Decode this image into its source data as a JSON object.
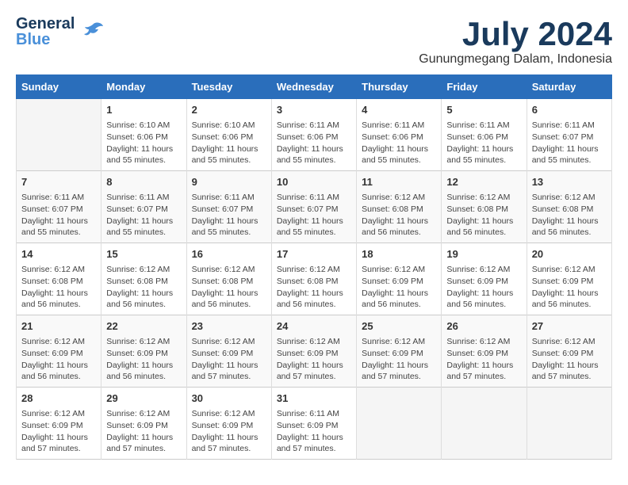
{
  "logo": {
    "line1": "General",
    "line2": "Blue"
  },
  "title": {
    "month_year": "July 2024",
    "location": "Gunungmegang Dalam, Indonesia"
  },
  "weekdays": [
    "Sunday",
    "Monday",
    "Tuesday",
    "Wednesday",
    "Thursday",
    "Friday",
    "Saturday"
  ],
  "weeks": [
    [
      {
        "day": "",
        "info": ""
      },
      {
        "day": "1",
        "info": "Sunrise: 6:10 AM\nSunset: 6:06 PM\nDaylight: 11 hours\nand 55 minutes."
      },
      {
        "day": "2",
        "info": "Sunrise: 6:10 AM\nSunset: 6:06 PM\nDaylight: 11 hours\nand 55 minutes."
      },
      {
        "day": "3",
        "info": "Sunrise: 6:11 AM\nSunset: 6:06 PM\nDaylight: 11 hours\nand 55 minutes."
      },
      {
        "day": "4",
        "info": "Sunrise: 6:11 AM\nSunset: 6:06 PM\nDaylight: 11 hours\nand 55 minutes."
      },
      {
        "day": "5",
        "info": "Sunrise: 6:11 AM\nSunset: 6:06 PM\nDaylight: 11 hours\nand 55 minutes."
      },
      {
        "day": "6",
        "info": "Sunrise: 6:11 AM\nSunset: 6:07 PM\nDaylight: 11 hours\nand 55 minutes."
      }
    ],
    [
      {
        "day": "7",
        "info": "Sunrise: 6:11 AM\nSunset: 6:07 PM\nDaylight: 11 hours\nand 55 minutes."
      },
      {
        "day": "8",
        "info": "Sunrise: 6:11 AM\nSunset: 6:07 PM\nDaylight: 11 hours\nand 55 minutes."
      },
      {
        "day": "9",
        "info": "Sunrise: 6:11 AM\nSunset: 6:07 PM\nDaylight: 11 hours\nand 55 minutes."
      },
      {
        "day": "10",
        "info": "Sunrise: 6:11 AM\nSunset: 6:07 PM\nDaylight: 11 hours\nand 55 minutes."
      },
      {
        "day": "11",
        "info": "Sunrise: 6:12 AM\nSunset: 6:08 PM\nDaylight: 11 hours\nand 56 minutes."
      },
      {
        "day": "12",
        "info": "Sunrise: 6:12 AM\nSunset: 6:08 PM\nDaylight: 11 hours\nand 56 minutes."
      },
      {
        "day": "13",
        "info": "Sunrise: 6:12 AM\nSunset: 6:08 PM\nDaylight: 11 hours\nand 56 minutes."
      }
    ],
    [
      {
        "day": "14",
        "info": "Sunrise: 6:12 AM\nSunset: 6:08 PM\nDaylight: 11 hours\nand 56 minutes."
      },
      {
        "day": "15",
        "info": "Sunrise: 6:12 AM\nSunset: 6:08 PM\nDaylight: 11 hours\nand 56 minutes."
      },
      {
        "day": "16",
        "info": "Sunrise: 6:12 AM\nSunset: 6:08 PM\nDaylight: 11 hours\nand 56 minutes."
      },
      {
        "day": "17",
        "info": "Sunrise: 6:12 AM\nSunset: 6:08 PM\nDaylight: 11 hours\nand 56 minutes."
      },
      {
        "day": "18",
        "info": "Sunrise: 6:12 AM\nSunset: 6:09 PM\nDaylight: 11 hours\nand 56 minutes."
      },
      {
        "day": "19",
        "info": "Sunrise: 6:12 AM\nSunset: 6:09 PM\nDaylight: 11 hours\nand 56 minutes."
      },
      {
        "day": "20",
        "info": "Sunrise: 6:12 AM\nSunset: 6:09 PM\nDaylight: 11 hours\nand 56 minutes."
      }
    ],
    [
      {
        "day": "21",
        "info": "Sunrise: 6:12 AM\nSunset: 6:09 PM\nDaylight: 11 hours\nand 56 minutes."
      },
      {
        "day": "22",
        "info": "Sunrise: 6:12 AM\nSunset: 6:09 PM\nDaylight: 11 hours\nand 56 minutes."
      },
      {
        "day": "23",
        "info": "Sunrise: 6:12 AM\nSunset: 6:09 PM\nDaylight: 11 hours\nand 57 minutes."
      },
      {
        "day": "24",
        "info": "Sunrise: 6:12 AM\nSunset: 6:09 PM\nDaylight: 11 hours\nand 57 minutes."
      },
      {
        "day": "25",
        "info": "Sunrise: 6:12 AM\nSunset: 6:09 PM\nDaylight: 11 hours\nand 57 minutes."
      },
      {
        "day": "26",
        "info": "Sunrise: 6:12 AM\nSunset: 6:09 PM\nDaylight: 11 hours\nand 57 minutes."
      },
      {
        "day": "27",
        "info": "Sunrise: 6:12 AM\nSunset: 6:09 PM\nDaylight: 11 hours\nand 57 minutes."
      }
    ],
    [
      {
        "day": "28",
        "info": "Sunrise: 6:12 AM\nSunset: 6:09 PM\nDaylight: 11 hours\nand 57 minutes."
      },
      {
        "day": "29",
        "info": "Sunrise: 6:12 AM\nSunset: 6:09 PM\nDaylight: 11 hours\nand 57 minutes."
      },
      {
        "day": "30",
        "info": "Sunrise: 6:12 AM\nSunset: 6:09 PM\nDaylight: 11 hours\nand 57 minutes."
      },
      {
        "day": "31",
        "info": "Sunrise: 6:11 AM\nSunset: 6:09 PM\nDaylight: 11 hours\nand 57 minutes."
      },
      {
        "day": "",
        "info": ""
      },
      {
        "day": "",
        "info": ""
      },
      {
        "day": "",
        "info": ""
      }
    ]
  ]
}
